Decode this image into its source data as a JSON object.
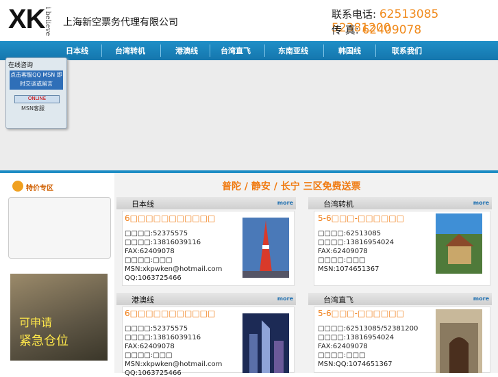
{
  "header": {
    "logo": "XK",
    "logo_sub": "i believe",
    "company": "上海新空票务代理有限公司",
    "tel_label": "联系电话:",
    "tel": "62513085 52381200",
    "fax_label": "传  真:",
    "fax": "62409078"
  },
  "nav": [
    "日本线",
    "台湾转机",
    "港澳线",
    "台湾直飞",
    "东南亚线",
    "韩国线",
    "联系我们"
  ],
  "consult": {
    "title": "在线咨询",
    "box": "点击客服QQ MSN 即时交谈或留言",
    "online": "ONLINE",
    "msn": "MSN客服"
  },
  "sidebar": {
    "title": "特价专区",
    "ad1": "可申请",
    "ad2": "紧急仓位"
  },
  "headline": "普陀 / 静安 / 长宁 三区免费送票",
  "cards": [
    {
      "head": "日本线",
      "more": "more",
      "title": "6□□□□□□□□□□□",
      "l1": "□□□□:52375575",
      "l2": "□□□□:13816039116",
      "l3": "FAX:62409078",
      "l4": "□□□□:□□□",
      "l5": "MSN:xkpwken@hotmail.com",
      "l6": "QQ:1063725466"
    },
    {
      "head": "台湾转机",
      "more": "more",
      "title": "5-6□□□-□□□□□□",
      "l1": "□□□□:62513085",
      "l2": "□□□□:13816954024",
      "l3": "FAX:62409078",
      "l4": "□□□□:□□□",
      "l5": "MSN:1074651367",
      "l6": ""
    },
    {
      "head": "港澳线",
      "more": "more",
      "title": "6□□□□□□□□□□□",
      "l1": "□□□□:52375575",
      "l2": "□□□□:13816039116",
      "l3": "FAX:62409078",
      "l4": "□□□□:□□□",
      "l5": "MSN:xkpwken@hotmail.com",
      "l6": "QQ:1063725466"
    },
    {
      "head": "台湾直飞",
      "more": "more",
      "title": "5-6□□□-□□□□□□",
      "l1": "□□□□:62513085/52381200",
      "l2": "□□□□:13816954024",
      "l3": "FAX:62409078",
      "l4": "□□□□:□□□",
      "l5": "MSN:QQ:1074651367",
      "l6": ""
    }
  ]
}
